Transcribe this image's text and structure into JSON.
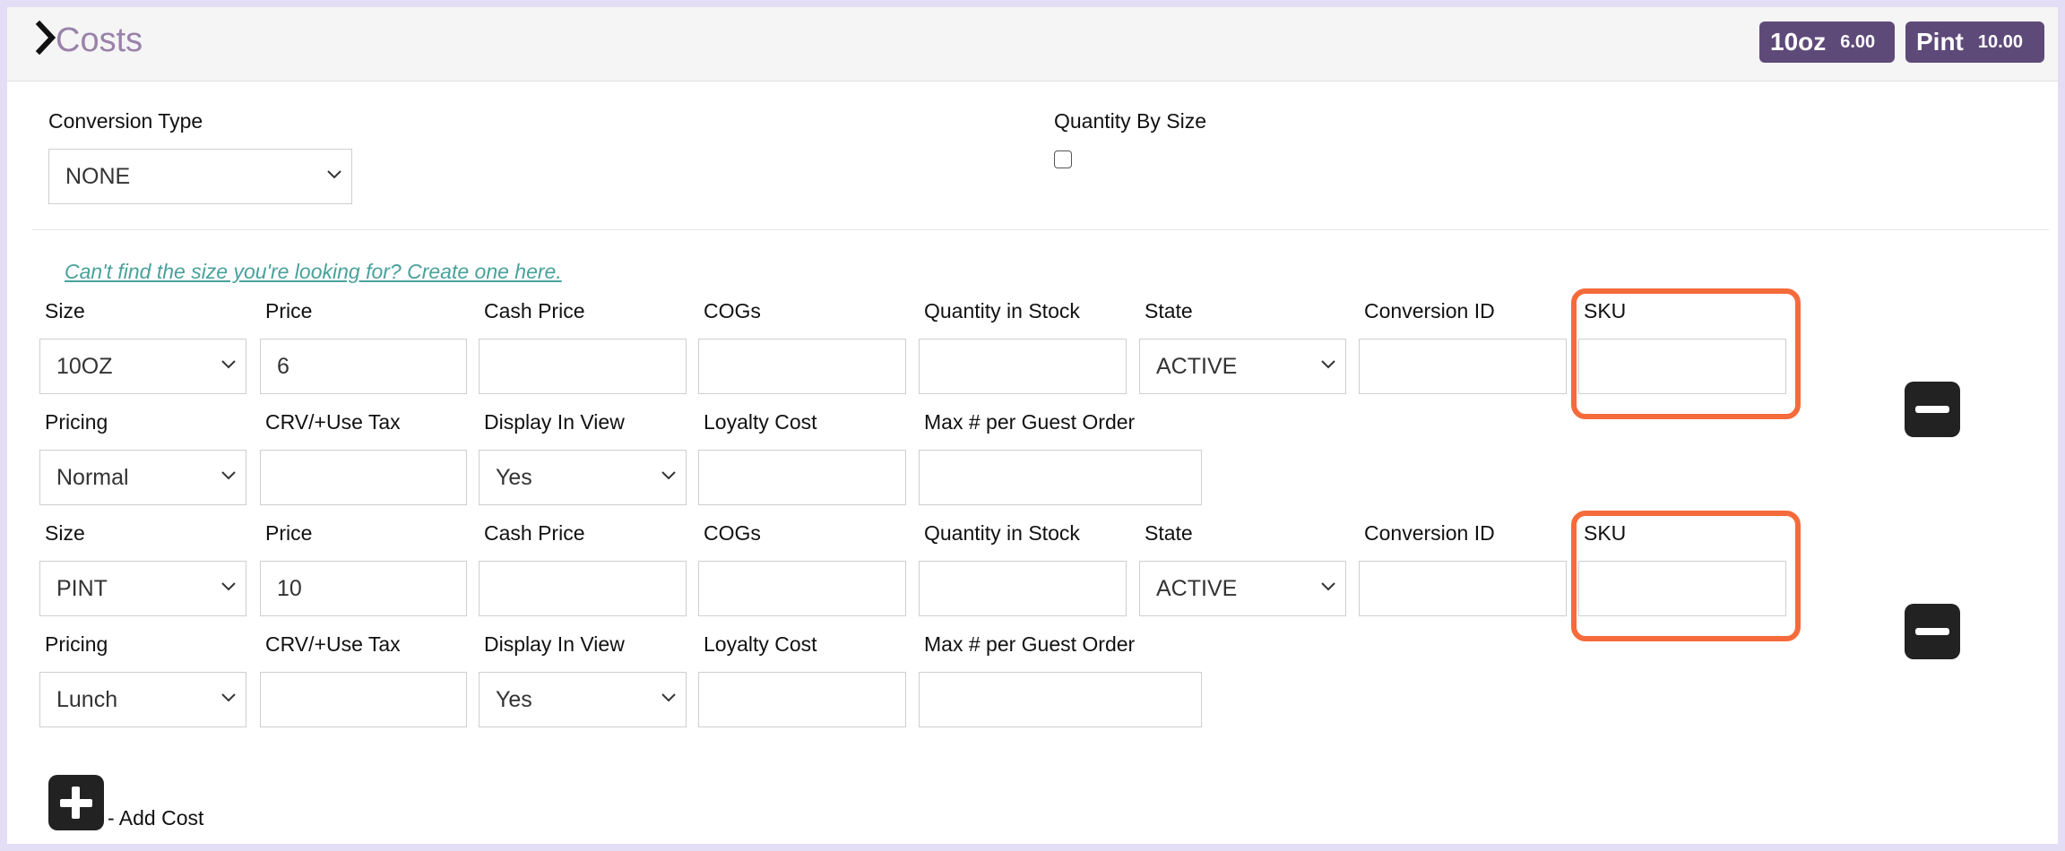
{
  "header": {
    "title": "Costs",
    "badges": [
      {
        "name": "10oz",
        "price": "6.00"
      },
      {
        "name": "Pint",
        "price": "10.00"
      }
    ]
  },
  "conversion": {
    "type_label": "Conversion Type",
    "type_value": "NONE",
    "qty_by_size_label": "Quantity By Size",
    "qty_by_size_checked": false
  },
  "create_link": "Can't find the size you're looking for? Create one here.",
  "labels": {
    "size": "Size",
    "price": "Price",
    "cash_price": "Cash Price",
    "cogs": "COGs",
    "qty_stock": "Quantity in Stock",
    "state": "State",
    "conversion_id": "Conversion ID",
    "sku": "SKU",
    "pricing": "Pricing",
    "crv_tax": "CRV/+Use Tax",
    "display_in_view": "Display In View",
    "loyalty_cost": "Loyalty Cost",
    "max_per_order": "Max # per Guest Order"
  },
  "costs": [
    {
      "size": "10OZ",
      "price": "6",
      "cash_price": "",
      "cogs": "",
      "qty_stock": "",
      "state": "ACTIVE",
      "conversion_id": "",
      "sku": "",
      "pricing": "Normal",
      "crv_tax": "",
      "display_in_view": "Yes",
      "loyalty_cost": "",
      "max_per_order": ""
    },
    {
      "size": "PINT",
      "price": "10",
      "cash_price": "",
      "cogs": "",
      "qty_stock": "",
      "state": "ACTIVE",
      "conversion_id": "",
      "sku": "",
      "pricing": "Lunch",
      "crv_tax": "",
      "display_in_view": "Yes",
      "loyalty_cost": "",
      "max_per_order": ""
    }
  ],
  "add_cost_label": "- Add Cost",
  "colors": {
    "accent": "#5e4a79",
    "title": "#9a82aa",
    "link": "#4aa19b",
    "highlight": "#f56b3b"
  },
  "icons": {
    "header": "chevron-right-icon",
    "remove": "minus-icon",
    "add": "plus-icon",
    "select": "chevron-down-icon"
  }
}
